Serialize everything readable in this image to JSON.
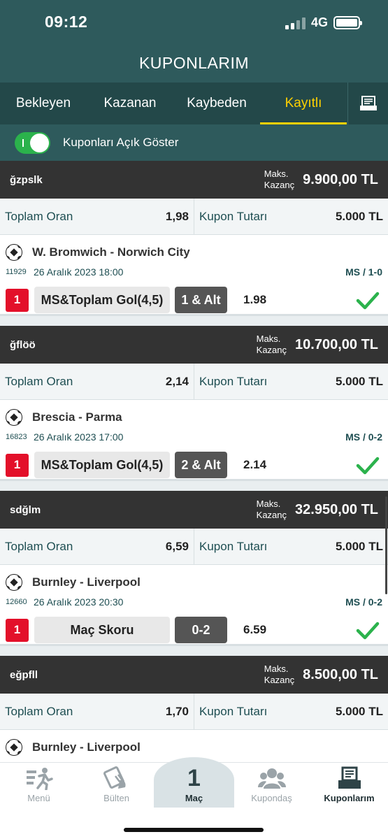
{
  "status": {
    "time": "09:12",
    "network": "4G"
  },
  "header": {
    "title": "KUPONLARIM"
  },
  "tabs": [
    {
      "label": "Bekleyen",
      "active": false
    },
    {
      "label": "Kazanan",
      "active": false
    },
    {
      "label": "Kaybeden",
      "active": false
    },
    {
      "label": "Kayıtlı",
      "active": true
    }
  ],
  "toggle": {
    "label": "Kuponları Açık Göster",
    "on": true
  },
  "coupons": [
    {
      "name": "ğzpslk",
      "max_label_1": "Maks.",
      "max_label_2": "Kazanç",
      "max_amount": "9.900,00 TL",
      "total_odds_label": "Toplam Oran",
      "total_odds": "1,98",
      "stake_label": "Kupon Tutarı",
      "stake": "5.000 TL",
      "match": {
        "title": "W. Bromwich - Norwich City",
        "code": "11929",
        "date": "26 Aralık 2023 18:00",
        "result": "MS / 1-0",
        "num": "1",
        "market": "MS&Toplam Gol(4,5)",
        "pick": "1 & Alt",
        "odd": "1.98"
      }
    },
    {
      "name": "ğflöö",
      "max_label_1": "Maks.",
      "max_label_2": "Kazanç",
      "max_amount": "10.700,00 TL",
      "total_odds_label": "Toplam Oran",
      "total_odds": "2,14",
      "stake_label": "Kupon Tutarı",
      "stake": "5.000 TL",
      "match": {
        "title": "Brescia - Parma",
        "code": "16823",
        "date": "26 Aralık 2023 17:00",
        "result": "MS / 0-2",
        "num": "1",
        "market": "MS&Toplam Gol(4,5)",
        "pick": "2 & Alt",
        "odd": "2.14"
      }
    },
    {
      "name": "sdğlm",
      "max_label_1": "Maks.",
      "max_label_2": "Kazanç",
      "max_amount": "32.950,00 TL",
      "total_odds_label": "Toplam Oran",
      "total_odds": "6,59",
      "stake_label": "Kupon Tutarı",
      "stake": "5.000 TL",
      "match": {
        "title": "Burnley - Liverpool",
        "code": "12660",
        "date": "26 Aralık 2023 20:30",
        "result": "MS / 0-2",
        "num": "1",
        "market": "Maç Skoru",
        "pick": "0-2",
        "odd": "6.59"
      }
    },
    {
      "name": "eğpfll",
      "max_label_1": "Maks.",
      "max_label_2": "Kazanç",
      "max_amount": "8.500,00 TL",
      "total_odds_label": "Toplam Oran",
      "total_odds": "1,70",
      "stake_label": "Kupon Tutarı",
      "stake": "5.000 TL",
      "match": {
        "title": "Burnley - Liverpool"
      }
    }
  ],
  "bottom_nav": {
    "items": [
      {
        "label": "Menü",
        "icon": "menu-runner-icon"
      },
      {
        "label": "Bülten",
        "icon": "bulletin-icon"
      },
      {
        "label": "Maç",
        "icon": "match-count",
        "count": "1"
      },
      {
        "label": "Kupondaş",
        "icon": "community-icon"
      },
      {
        "label": "Kuponlarım",
        "icon": "coupons-icon",
        "active": true
      }
    ]
  },
  "colors": {
    "header_bg": "#2e5a5c",
    "tabs_bg": "#234849",
    "active_tab": "#ffd100",
    "win_check": "#2bb24c",
    "selection_num": "#e3102a"
  }
}
